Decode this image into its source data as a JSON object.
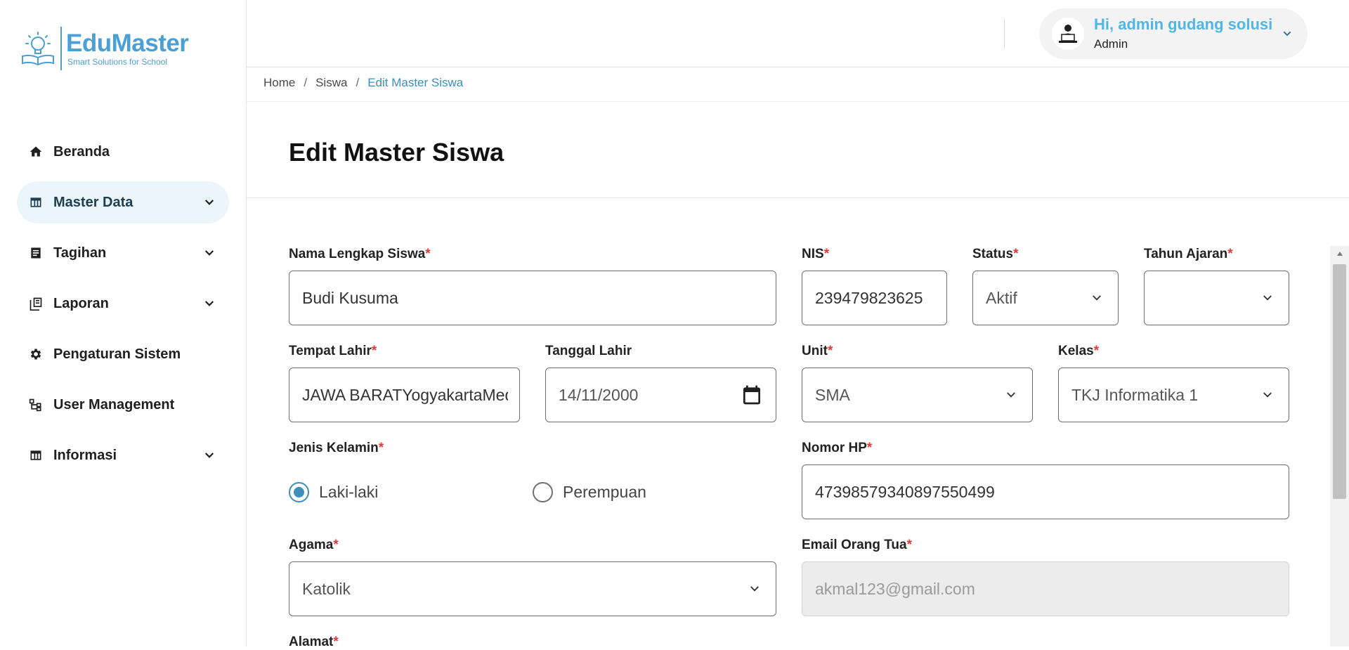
{
  "brand": {
    "name": "EduMaster",
    "tagline": "Smart Solutions for School"
  },
  "sidebar": {
    "items": [
      {
        "label": "Beranda",
        "icon": "home-icon",
        "active": false,
        "has_submenu": false
      },
      {
        "label": "Master Data",
        "icon": "table-icon",
        "active": true,
        "has_submenu": true
      },
      {
        "label": "Tagihan",
        "icon": "document-icon",
        "active": false,
        "has_submenu": true
      },
      {
        "label": "Laporan",
        "icon": "library-icon",
        "active": false,
        "has_submenu": true
      },
      {
        "label": "Pengaturan Sistem",
        "icon": "gear-icon",
        "active": false,
        "has_submenu": false
      },
      {
        "label": "User Management",
        "icon": "hierarchy-icon",
        "active": false,
        "has_submenu": false
      },
      {
        "label": "Informasi",
        "icon": "table-icon",
        "active": false,
        "has_submenu": true
      }
    ]
  },
  "header": {
    "greeting": "Hi, admin gudang solusi",
    "role": "Admin"
  },
  "breadcrumb": {
    "home": "Home",
    "parent": "Siswa",
    "current": "Edit Master Siswa",
    "separator": "/"
  },
  "page": {
    "title": "Edit Master Siswa"
  },
  "form": {
    "required_mark": "*",
    "nama": {
      "label": "Nama Lengkap Siswa",
      "value": "Budi Kusuma"
    },
    "nis": {
      "label": "NIS",
      "value": "239479823625"
    },
    "status": {
      "label": "Status",
      "value": "Aktif"
    },
    "tahun_ajaran": {
      "label": "Tahun Ajaran",
      "value": ""
    },
    "tempat_lahir": {
      "label": "Tempat Lahir",
      "value": "JAWA BARATYogyakartaMedan"
    },
    "tanggal_lahir": {
      "label": "Tanggal Lahir",
      "value": "14/11/2000"
    },
    "unit": {
      "label": "Unit",
      "value": "SMA"
    },
    "kelas": {
      "label": "Kelas",
      "value": "TKJ Informatika 1"
    },
    "jenis_kelamin": {
      "label": "Jenis Kelamin",
      "options": [
        "Laki-laki",
        "Perempuan"
      ],
      "selected": "Laki-laki"
    },
    "nomor_hp": {
      "label": "Nomor HP",
      "value": "47398579340897550499"
    },
    "agama": {
      "label": "Agama",
      "value": "Katolik"
    },
    "email_ortu": {
      "label": "Email Orang Tua",
      "value": "akmal123@gmail.com"
    },
    "alamat": {
      "label": "Alamat"
    }
  },
  "colors": {
    "accent": "#3a8fbd",
    "brand": "#4a9fd4",
    "required": "#e53935",
    "active_bg": "#eaf6fc"
  }
}
